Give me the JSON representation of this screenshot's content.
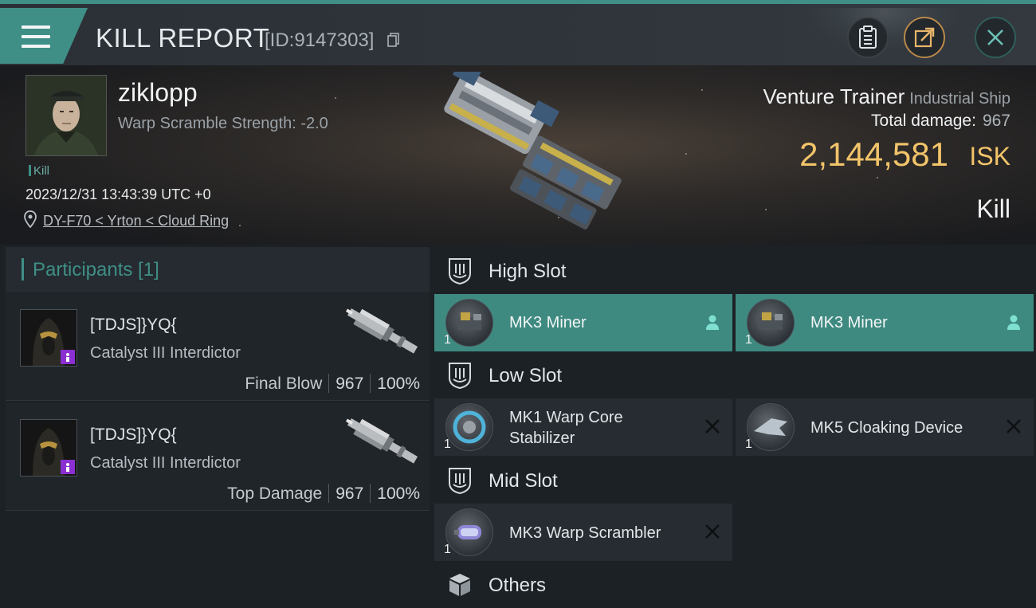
{
  "header": {
    "title": "KILL REPORT",
    "report_id": "[ID:9147303]",
    "icons": [
      "menu-icon",
      "copy-icon",
      "clipboard-icon",
      "share-icon",
      "close-icon"
    ]
  },
  "victim": {
    "name": "ziklopp",
    "warp_scramble": "Warp Scramble Strength: -2.0",
    "tag": "Kill",
    "datetime": "2023/12/31 13:43:39 UTC +0",
    "location": "DY-F70 < Yrton < Cloud Ring"
  },
  "ship": {
    "name": "Venture Trainer",
    "class": "Industrial Ship",
    "total_damage_label": "Total damage:",
    "total_damage": "967",
    "isk_value": "2,144,581",
    "isk_unit": "ISK",
    "result": "Kill"
  },
  "participants": {
    "title": "Participants [1]",
    "items": [
      {
        "name": "[TDJS]}YQ{",
        "ship": "Catalyst III Interdictor",
        "label": "Final Blow",
        "damage": "967",
        "percent": "100%"
      },
      {
        "name": "[TDJS]}YQ{",
        "ship": "Catalyst III Interdictor",
        "label": "Top Damage",
        "damage": "967",
        "percent": "100%"
      }
    ]
  },
  "slots": {
    "high": {
      "title": "High Slot",
      "items": [
        {
          "name": "MK3 Miner",
          "qty": "1",
          "status": "user-icon"
        },
        {
          "name": "MK3 Miner",
          "qty": "1",
          "status": "user-icon"
        }
      ]
    },
    "low": {
      "title": "Low Slot",
      "items": [
        {
          "name_line1": "MK1 Warp Core",
          "name_line2": "Stabilizer",
          "qty": "1",
          "status": "destroyed-icon"
        },
        {
          "name": "MK5 Cloaking Device",
          "qty": "1",
          "status": "destroyed-icon"
        }
      ]
    },
    "mid": {
      "title": "Mid Slot",
      "items": [
        {
          "name": "MK3 Warp Scrambler",
          "qty": "1",
          "status": "destroyed-icon"
        }
      ]
    },
    "others": {
      "title": "Others"
    }
  },
  "colors": {
    "accent": "#3f8f86",
    "isk": "#f2c46a",
    "badge": "#8a2fd1"
  }
}
